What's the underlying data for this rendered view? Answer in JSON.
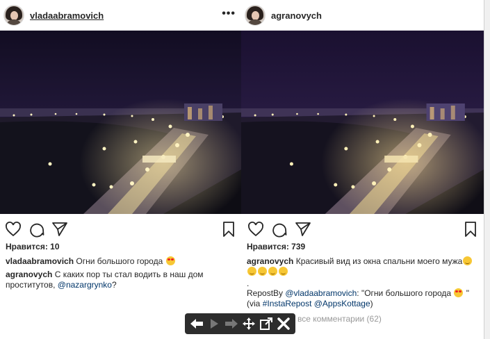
{
  "left_post": {
    "username": "vladaabramovich",
    "more_label": "•••",
    "likes": "Нравится: 10",
    "caption": {
      "user": "vladaabramovich",
      "text": "Огни большого города"
    },
    "comment": {
      "user": "agranovych",
      "text": "С каких пор ты стал водить в наш дом проститутов,",
      "mention": "@nazargrynko",
      "suffix": "?"
    }
  },
  "right_post": {
    "username": "agranovych",
    "likes": "Нравится: 739",
    "caption": {
      "user": "agranovych",
      "text": "Красивый вид из окна спальни моего мужа"
    },
    "dot": ".",
    "repost": {
      "prefix": "RepostBy",
      "mention": "@vladaabramovich",
      "text": ": \"Огни большого города",
      "suffix": "\" (via",
      "tag": "#InstaRepost",
      "app": "@AppsKottage",
      "close": ")"
    },
    "view_all": "все комментарии (62)"
  },
  "icons": {
    "like": "heart-icon",
    "comment": "comment-icon",
    "share": "send-icon",
    "save": "bookmark-icon",
    "toolbar": [
      "arrow-left-icon",
      "arrow-right-icon",
      "arrow-right-icon",
      "move-icon",
      "open-external-icon",
      "close-icon"
    ]
  },
  "colors": {
    "night_sky": "#1b1530",
    "city_lights": "#ffd27a",
    "toolbar_bg": "#2d2d2d"
  }
}
